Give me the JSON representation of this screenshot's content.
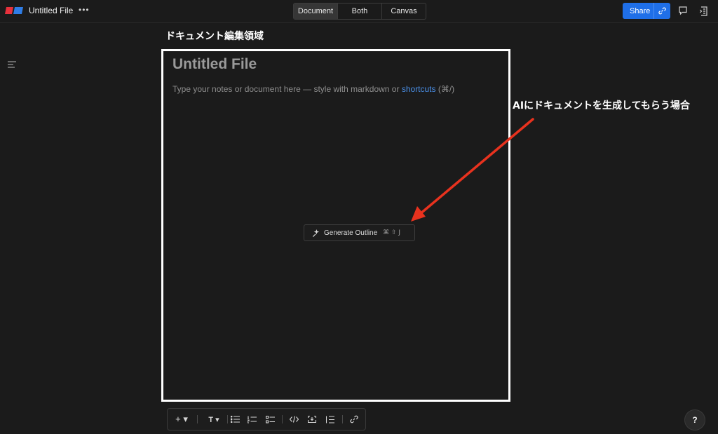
{
  "header": {
    "file_title": "Untitled File",
    "more_label": "•••",
    "view_tabs": [
      {
        "label": "Document",
        "active": true
      },
      {
        "label": "Both",
        "active": false
      },
      {
        "label": "Canvas",
        "active": false
      }
    ],
    "share_label": "Share",
    "icons": [
      "app-logo",
      "link-icon",
      "comment-icon",
      "outline-icon"
    ]
  },
  "annotations": {
    "editor_area_label": "ドキュメント編集領域",
    "ai_label": "AIにドキュメントを生成してもらう場合",
    "highlight_color": "#ffffff",
    "arrow_color": "#e8321e"
  },
  "document": {
    "title": "Untitled File",
    "placeholder_prefix": "Type your notes or document here — style with markdown or ",
    "placeholder_link": "shortcuts",
    "placeholder_suffix": " (⌘/)",
    "generate_label": "Generate Outline",
    "generate_shortcut": "⌘ ⇧ J"
  },
  "toolbar": {
    "add_label": "+ ▾",
    "text_label": "T ▾",
    "items": [
      "add",
      "text-style",
      "bullet-list",
      "numbered-list",
      "checklist",
      "code",
      "embed",
      "quote",
      "link"
    ]
  },
  "help_label": "?",
  "colors": {
    "background": "#1b1b1b",
    "accent": "#1f6fe8",
    "link": "#4a8fe7"
  }
}
